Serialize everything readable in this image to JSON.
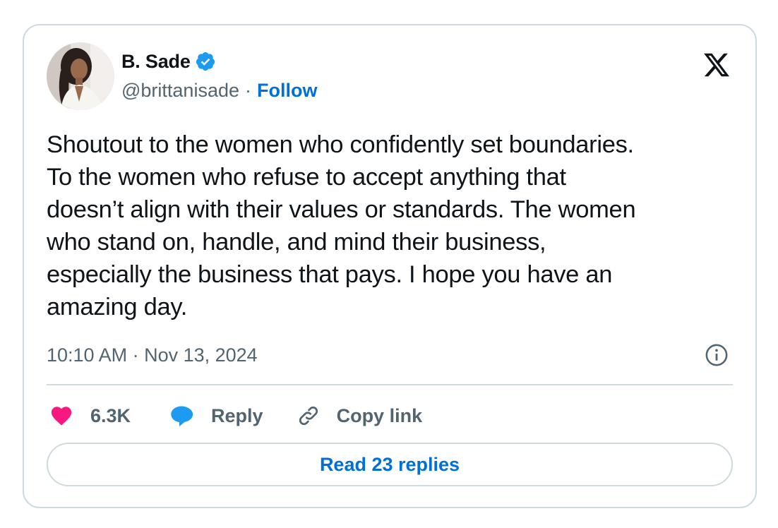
{
  "author": {
    "display_name": "B. Sade",
    "verified": true,
    "handle": "@brittanisade",
    "separator": "·",
    "follow_label": "Follow"
  },
  "tweet": {
    "text": "Shoutout to the women who confidently set boundaries.\nTo the women who refuse to accept anything that\ndoesn’t align with their values or standards. The women\nwho stand on, handle, and mind their business,\nespecially the business that pays. I hope you have an\namazing day.",
    "timestamp": "10:10 AM · Nov 13, 2024"
  },
  "actions": {
    "like_count": "6.3K",
    "reply_label": "Reply",
    "copy_link_label": "Copy link"
  },
  "read_replies_label": "Read 23 replies",
  "colors": {
    "like": "#f91880",
    "reply": "#1d9bf0",
    "link": "#006fd6",
    "verified": "#1d9bf0",
    "border": "#cfd9de",
    "text": "#0f1419",
    "muted": "#536471"
  },
  "icons": [
    "x-logo-icon",
    "verified-badge-icon",
    "info-icon",
    "heart-icon",
    "reply-bubble-icon",
    "link-icon"
  ]
}
